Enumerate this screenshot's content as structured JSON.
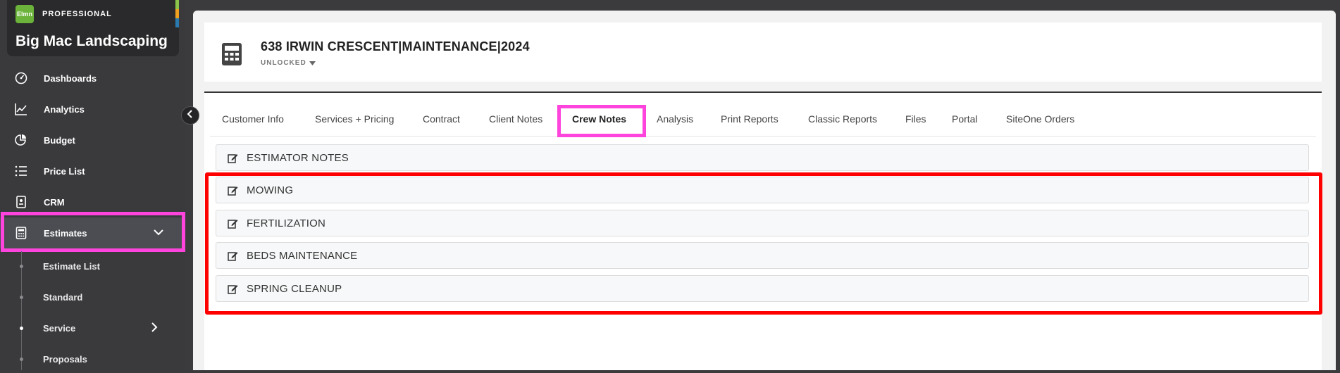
{
  "app": {
    "logo_text": "Elmn",
    "tier": "PROFESSIONAL",
    "company_name": "Big Mac Landscaping"
  },
  "colors": {
    "highlight_magenta": "#ff44dd",
    "highlight_red": "#ff0000",
    "brand_green": "#6bb33a",
    "sidebar_bg": "#3a3a3d"
  },
  "sidebar": {
    "items": [
      {
        "label": "Dashboards",
        "icon": "gauge-icon"
      },
      {
        "label": "Analytics",
        "icon": "line-chart-icon"
      },
      {
        "label": "Budget",
        "icon": "pie-chart-icon"
      },
      {
        "label": "Price List",
        "icon": "list-icon"
      },
      {
        "label": "CRM",
        "icon": "contact-card-icon"
      },
      {
        "label": "Estimates",
        "icon": "calculator-icon"
      }
    ],
    "sub_items": [
      {
        "label": "Estimate List"
      },
      {
        "label": "Standard"
      },
      {
        "label": "Service"
      },
      {
        "label": "Proposals"
      }
    ]
  },
  "estimate": {
    "title": "638 IRWIN CRESCENT|MAINTENANCE|2024",
    "status": "UNLOCKED"
  },
  "tabs": [
    {
      "label": "Customer Info"
    },
    {
      "label": "Services + Pricing"
    },
    {
      "label": "Contract"
    },
    {
      "label": "Client Notes"
    },
    {
      "label": "Crew Notes"
    },
    {
      "label": "Analysis"
    },
    {
      "label": "Print Reports"
    },
    {
      "label": "Classic Reports"
    },
    {
      "label": "Files"
    },
    {
      "label": "Portal"
    },
    {
      "label": "SiteOne Orders"
    }
  ],
  "active_tab": "Crew Notes",
  "sections": [
    {
      "label": "ESTIMATOR NOTES"
    },
    {
      "label": "MOWING"
    },
    {
      "label": "FERTILIZATION"
    },
    {
      "label": "BEDS MAINTENANCE"
    },
    {
      "label": "SPRING CLEANUP"
    }
  ]
}
